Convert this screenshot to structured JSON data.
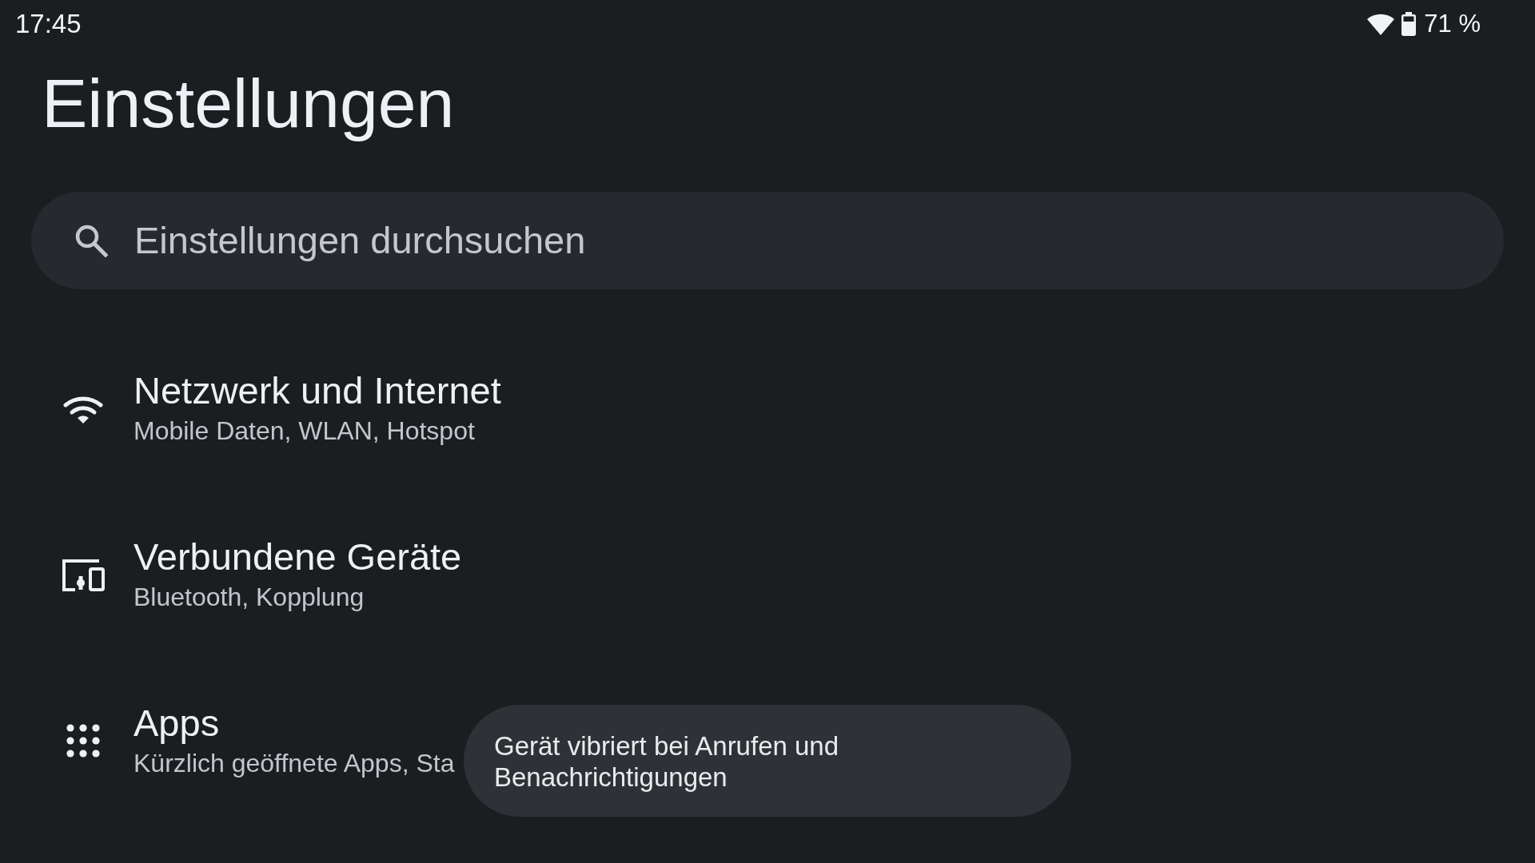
{
  "status_bar": {
    "time": "17:45",
    "battery": "71 %"
  },
  "title": "Einstellungen",
  "search": {
    "placeholder": "Einstellungen durchsuchen"
  },
  "items": [
    {
      "title": "Netzwerk und Internet",
      "subtitle": "Mobile Daten, WLAN, Hotspot"
    },
    {
      "title": "Verbundene Geräte",
      "subtitle": "Bluetooth, Kopplung"
    },
    {
      "title": "Apps",
      "subtitle": "Kürzlich geöffnete Apps, Sta"
    }
  ],
  "toast": {
    "text": "Gerät vibriert bei Anrufen und Benachrichtigungen"
  }
}
